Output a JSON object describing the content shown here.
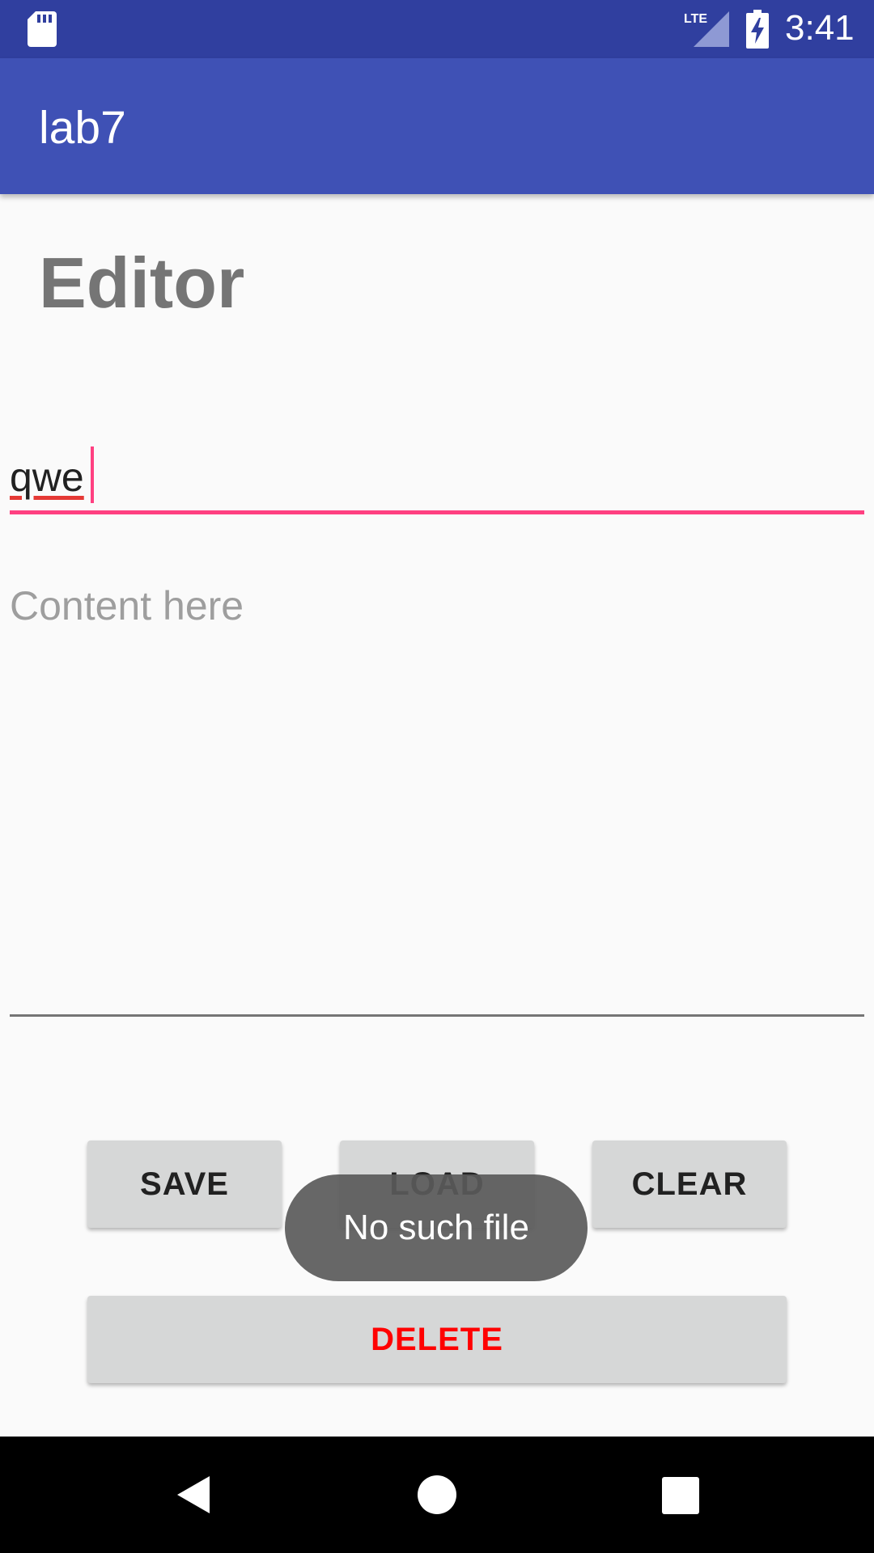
{
  "status_bar": {
    "time": "3:41",
    "icons": [
      "sd-card-icon",
      "lte-signal-icon",
      "battery-charging-icon"
    ],
    "background": "#303f9f"
  },
  "app_bar": {
    "title": "lab7",
    "background": "#3f51b5"
  },
  "editor": {
    "heading": "Editor",
    "filename_value": "qwe",
    "content_placeholder": "Content here",
    "accent_color": "#ff4081"
  },
  "buttons": {
    "save": "SAVE",
    "load": "LOAD",
    "clear": "CLEAR",
    "delete": "DELETE",
    "delete_color": "#ff0000"
  },
  "toast": {
    "message": "No such file"
  },
  "nav_bar": {
    "icons": [
      "back-icon",
      "home-icon",
      "recents-icon"
    ]
  }
}
